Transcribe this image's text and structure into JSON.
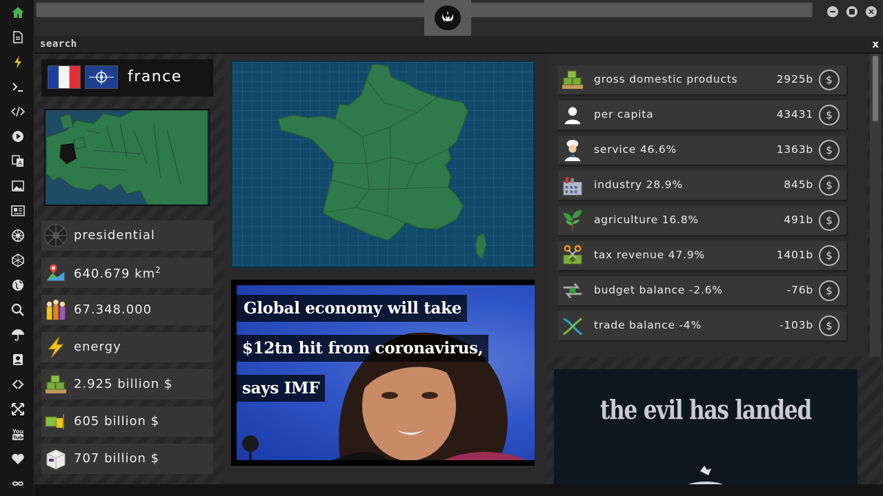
{
  "sidebar": {
    "items": [
      {
        "name": "home-icon",
        "color": "#4caf50"
      },
      {
        "name": "document-icon"
      },
      {
        "name": "lightning-icon",
        "color": "#f5c518"
      },
      {
        "name": "terminal-icon"
      },
      {
        "name": "code-icon"
      },
      {
        "name": "play-icon"
      },
      {
        "name": "translate-icon"
      },
      {
        "name": "image-icon"
      },
      {
        "name": "news-icon"
      },
      {
        "name": "empire-icon"
      },
      {
        "name": "hexagon-icon"
      },
      {
        "name": "globe-icon"
      },
      {
        "name": "search-icon"
      },
      {
        "name": "umbrella-icon"
      },
      {
        "name": "contact-icon"
      },
      {
        "name": "link-icon"
      },
      {
        "name": "expand-icon"
      },
      {
        "name": "youtube-icon"
      },
      {
        "name": "heart-icon"
      },
      {
        "name": "infinity-icon"
      }
    ]
  },
  "search": {
    "label": "search",
    "close": "x"
  },
  "country": {
    "name": "france",
    "government": "presidential",
    "area": "640.679 km",
    "area_unit_sup": "2",
    "population": "67.348.000",
    "resource": "energy",
    "gdp": "2.925 billion $",
    "imports": "605 billion $",
    "exports": "707 billion $"
  },
  "news": {
    "lines": [
      "Global economy will take",
      "$12tn hit from coronavirus,",
      "says IMF"
    ]
  },
  "stats": [
    {
      "label": "gross domestic products",
      "value": "2925b",
      "icon": "money-pallet-icon"
    },
    {
      "label": "per capita",
      "value": "43431",
      "icon": "person-icon"
    },
    {
      "label": "service 46.6%",
      "value": "1363b",
      "icon": "chef-icon"
    },
    {
      "label": "industry 28.9%",
      "value": "845b",
      "icon": "factory-icon"
    },
    {
      "label": "agriculture 16.8%",
      "value": "491b",
      "icon": "plant-icon"
    },
    {
      "label": "tax revenue 47.9%",
      "value": "1401b",
      "icon": "scissors-money-icon"
    },
    {
      "label": "budget balance -2.6%",
      "value": "-76b",
      "icon": "balance-arrows-icon"
    },
    {
      "label": "trade balance -4%",
      "value": "-103b",
      "icon": "trade-cross-icon"
    }
  ],
  "dollar_symbol": "$",
  "banner": {
    "text": "the evil has landed"
  },
  "colors": {
    "accent_green": "#2f7a4a",
    "map_sea": "#0f4a6b",
    "panel": "#363636"
  }
}
